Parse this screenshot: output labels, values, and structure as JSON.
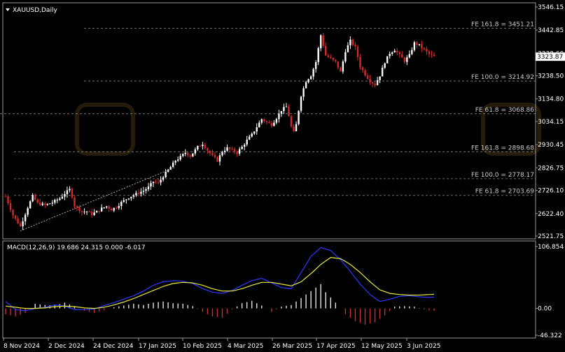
{
  "chart_data": [
    {
      "type": "candlestick",
      "title": "XAUUSD,Daily",
      "symbol": "XAUUSD",
      "timeframe": "Daily",
      "ylim": [
        2521.75,
        3546.15
      ],
      "y_ticks": [
        "3546.15",
        "3442.85",
        "3338.60",
        "3238.50",
        "3134.80",
        "3034.15",
        "2930.45",
        "2826.75",
        "2726.10",
        "2622.40",
        "2521.75"
      ],
      "last_price": "3323.87",
      "x_ticks": [
        "8 Nov 2024",
        "2 Dec 2024",
        "24 Dec 2024",
        "17 Jan 2025",
        "10 Feb 2025",
        "4 Mar 2025",
        "26 Mar 2025",
        "17 Apr 2025",
        "12 May 2025",
        "3 Jun 2025"
      ],
      "fib_levels": [
        {
          "label": "FE 161.8 = 3451.21",
          "value": 3451.21
        },
        {
          "label": "FE 100.0 = 3214.92",
          "value": 3214.92
        },
        {
          "label": "FE 61.8 = 3068.86",
          "value": 3068.86
        },
        {
          "label": "FE 161.8 = 2898.68",
          "value": 2898.68
        },
        {
          "label": "FE 100.0 = 2778.17",
          "value": 2778.17
        },
        {
          "label": "FE 61.8 = 2703.69",
          "value": 2703.69
        }
      ],
      "close_path": [
        [
          0,
          2700
        ],
        [
          3,
          2615
        ],
        [
          6,
          2565
        ],
        [
          9,
          2650
        ],
        [
          11,
          2700
        ],
        [
          13,
          2668
        ],
        [
          16,
          2660
        ],
        [
          19,
          2672
        ],
        [
          22,
          2690
        ],
        [
          24,
          2712
        ],
        [
          26,
          2730
        ],
        [
          27,
          2700
        ],
        [
          28,
          2658
        ],
        [
          31,
          2630
        ],
        [
          33,
          2632
        ],
        [
          35,
          2620
        ],
        [
          37,
          2630
        ],
        [
          39,
          2645
        ],
        [
          41,
          2655
        ],
        [
          43,
          2640
        ],
        [
          45,
          2652
        ],
        [
          47,
          2672
        ],
        [
          50,
          2695
        ],
        [
          53,
          2710
        ],
        [
          56,
          2725
        ],
        [
          58,
          2740
        ],
        [
          60,
          2765
        ],
        [
          62,
          2758
        ],
        [
          64,
          2790
        ],
        [
          67,
          2830
        ],
        [
          69,
          2860
        ],
        [
          71,
          2875
        ],
        [
          73,
          2895
        ],
        [
          75,
          2880
        ],
        [
          78,
          2920
        ],
        [
          80,
          2935
        ],
        [
          82,
          2905
        ],
        [
          84,
          2880
        ],
        [
          86,
          2860
        ],
        [
          88,
          2900
        ],
        [
          90,
          2915
        ],
        [
          92,
          2905
        ],
        [
          94,
          2895
        ],
        [
          96,
          2920
        ],
        [
          98,
          2950
        ],
        [
          100,
          2975
        ],
        [
          102,
          3010
        ],
        [
          104,
          3045
        ],
        [
          106,
          3030
        ],
        [
          108,
          3020
        ],
        [
          110,
          3050
        ],
        [
          112,
          3085
        ],
        [
          114,
          3100
        ],
        [
          115,
          3060
        ],
        [
          116,
          3010
        ],
        [
          117,
          2985
        ],
        [
          118,
          3020
        ],
        [
          120,
          3150
        ],
        [
          122,
          3215
        ],
        [
          124,
          3240
        ],
        [
          126,
          3300
        ],
        [
          128,
          3420
        ],
        [
          130,
          3330
        ],
        [
          132,
          3315
        ],
        [
          134,
          3300
        ],
        [
          136,
          3255
        ],
        [
          138,
          3350
        ],
        [
          140,
          3395
        ],
        [
          142,
          3365
        ],
        [
          144,
          3280
        ],
        [
          146,
          3245
        ],
        [
          148,
          3215
        ],
        [
          150,
          3200
        ],
        [
          152,
          3240
        ],
        [
          154,
          3300
        ],
        [
          156,
          3340
        ],
        [
          158,
          3355
        ],
        [
          160,
          3330
        ],
        [
          162,
          3305
        ],
        [
          164,
          3330
        ],
        [
          166,
          3385
        ],
        [
          168,
          3375
        ],
        [
          170,
          3355
        ],
        [
          172,
          3335
        ],
        [
          174,
          3323.87
        ]
      ]
    },
    {
      "type": "macd",
      "title": "MACD(12,26,9) 19.686 24.315 0.000 -6.017",
      "params": [
        12,
        26,
        9
      ],
      "ylim": [
        -46.322,
        106.854
      ],
      "y_ticks": [
        "106.854",
        "0.00",
        "-46.322"
      ],
      "histogram": [
        [
          0,
          -10
        ],
        [
          4,
          -14
        ],
        [
          8,
          -8
        ],
        [
          12,
          8
        ],
        [
          16,
          6
        ],
        [
          20,
          5
        ],
        [
          24,
          10
        ],
        [
          28,
          4
        ],
        [
          32,
          -4
        ],
        [
          36,
          -8
        ],
        [
          40,
          -3
        ],
        [
          44,
          2
        ],
        [
          48,
          5
        ],
        [
          52,
          8
        ],
        [
          56,
          6
        ],
        [
          60,
          10
        ],
        [
          64,
          12
        ],
        [
          68,
          9
        ],
        [
          72,
          8
        ],
        [
          76,
          4
        ],
        [
          80,
          -6
        ],
        [
          84,
          -14
        ],
        [
          88,
          -16
        ],
        [
          92,
          -2
        ],
        [
          96,
          9
        ],
        [
          100,
          13
        ],
        [
          104,
          5
        ],
        [
          108,
          -6
        ],
        [
          112,
          3
        ],
        [
          116,
          6
        ],
        [
          120,
          18
        ],
        [
          124,
          30
        ],
        [
          128,
          42
        ],
        [
          130,
          28
        ],
        [
          134,
          10
        ],
        [
          138,
          -10
        ],
        [
          142,
          -22
        ],
        [
          146,
          -28
        ],
        [
          150,
          -24
        ],
        [
          154,
          -12
        ],
        [
          158,
          3
        ],
        [
          162,
          4
        ],
        [
          166,
          3
        ],
        [
          170,
          -2
        ],
        [
          174,
          -4
        ]
      ],
      "macd_line": [
        [
          0,
          12
        ],
        [
          4,
          -2
        ],
        [
          8,
          -4
        ],
        [
          12,
          0
        ],
        [
          16,
          2
        ],
        [
          20,
          6
        ],
        [
          24,
          4
        ],
        [
          28,
          -2
        ],
        [
          32,
          -2
        ],
        [
          36,
          -1
        ],
        [
          40,
          5
        ],
        [
          44,
          10
        ],
        [
          48,
          16
        ],
        [
          52,
          22
        ],
        [
          56,
          30
        ],
        [
          60,
          40
        ],
        [
          64,
          46
        ],
        [
          68,
          48
        ],
        [
          72,
          47
        ],
        [
          76,
          43
        ],
        [
          80,
          34
        ],
        [
          84,
          28
        ],
        [
          88,
          26
        ],
        [
          92,
          31
        ],
        [
          96,
          40
        ],
        [
          100,
          48
        ],
        [
          104,
          52
        ],
        [
          108,
          44
        ],
        [
          112,
          36
        ],
        [
          116,
          34
        ],
        [
          120,
          62
        ],
        [
          124,
          90
        ],
        [
          128,
          105
        ],
        [
          132,
          100
        ],
        [
          136,
          84
        ],
        [
          140,
          64
        ],
        [
          144,
          42
        ],
        [
          148,
          24
        ],
        [
          152,
          12
        ],
        [
          156,
          16
        ],
        [
          160,
          21
        ],
        [
          164,
          22
        ],
        [
          168,
          20
        ],
        [
          172,
          19
        ],
        [
          174,
          19.686
        ]
      ],
      "signal_line": [
        [
          0,
          4
        ],
        [
          4,
          2
        ],
        [
          8,
          0
        ],
        [
          12,
          0
        ],
        [
          16,
          1
        ],
        [
          20,
          3
        ],
        [
          24,
          4
        ],
        [
          28,
          3
        ],
        [
          32,
          1
        ],
        [
          36,
          0
        ],
        [
          40,
          2
        ],
        [
          44,
          6
        ],
        [
          48,
          11
        ],
        [
          52,
          17
        ],
        [
          56,
          24
        ],
        [
          60,
          31
        ],
        [
          64,
          38
        ],
        [
          68,
          43
        ],
        [
          72,
          45
        ],
        [
          76,
          44
        ],
        [
          80,
          40
        ],
        [
          84,
          34
        ],
        [
          88,
          30
        ],
        [
          92,
          30
        ],
        [
          96,
          34
        ],
        [
          100,
          40
        ],
        [
          104,
          45
        ],
        [
          108,
          45
        ],
        [
          112,
          42
        ],
        [
          116,
          39
        ],
        [
          120,
          46
        ],
        [
          124,
          60
        ],
        [
          128,
          76
        ],
        [
          132,
          88
        ],
        [
          136,
          86
        ],
        [
          140,
          76
        ],
        [
          144,
          62
        ],
        [
          148,
          46
        ],
        [
          152,
          32
        ],
        [
          156,
          26
        ],
        [
          160,
          24
        ],
        [
          164,
          23
        ],
        [
          168,
          23
        ],
        [
          172,
          24
        ],
        [
          174,
          24.315
        ]
      ]
    }
  ]
}
